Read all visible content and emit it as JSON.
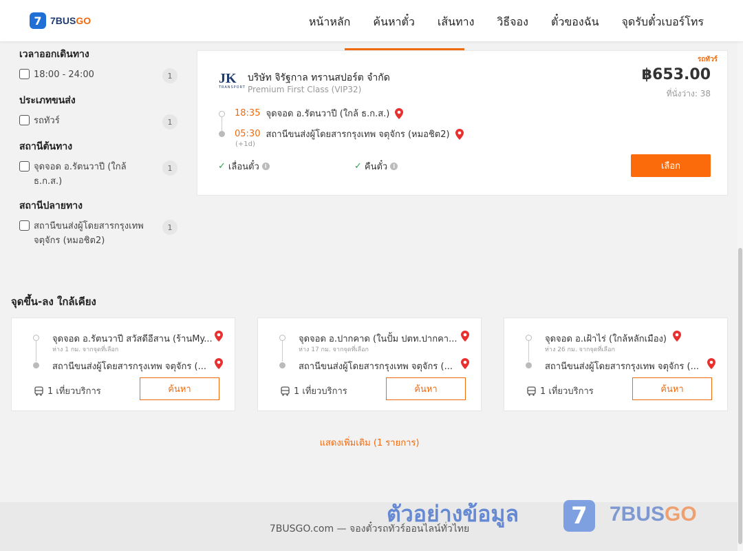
{
  "header": {
    "logo_seven": "7",
    "logo_bus": "7BUS",
    "logo_go": "GO",
    "nav": [
      "หน้าหลัก",
      "ค้นหาตั๋ว",
      "เส้นทาง",
      "วิธีจอง",
      "ตั๋วของฉัน",
      "จุดรับตั๋วเบอร์โทร"
    ]
  },
  "filters": [
    {
      "title": "เวลาออกเดินทาง",
      "items": [
        {
          "label": "18:00 - 24:00",
          "count": "1"
        }
      ]
    },
    {
      "title": "ประเภทขนส่ง",
      "items": [
        {
          "label": "รถทัวร์",
          "count": "1"
        }
      ]
    },
    {
      "title": "สถานีต้นทาง",
      "items": [
        {
          "label": "จุดจอด อ.รัตนวาปี (ใกล้ ธ.ก.ส.)",
          "count": "1"
        }
      ]
    },
    {
      "title": "สถานีปลายทาง",
      "items": [
        {
          "label": "สถานีขนส่งผู้โดยสารกรุงเทพ จตุจักร (หมอชิต2)",
          "count": "1"
        }
      ]
    }
  ],
  "trip": {
    "tag": "รถทัวร์",
    "operator_logo": "JK",
    "operator_logo_sub": "TRANSPORT",
    "operator": "บริษัท จิรัฐกาล ทรานสปอร์ต จำกัด",
    "class": "Premium First Class (VIP32)",
    "price": "฿653.00",
    "seats": "ที่นั่งว่าง: 38",
    "depart_time": "18:35",
    "depart_place": "จุดจอด อ.รัตนวาปี (ใกล้ ธ.ก.ส.)",
    "arrive_time": "05:30",
    "arrive_place": "สถานีขนส่งผู้โดยสารกรุงเทพ จตุจักร (หมอชิต2)",
    "next_day": "(+1d)",
    "feature_reschedule": "เลื่อนตั๋ว",
    "feature_refund": "คืนตั๋ว",
    "select_label": "เลือก"
  },
  "nearby": {
    "title": "จุดขึ้น-ลง ใกล้เคียง",
    "cards": [
      {
        "from": "จุดจอด อ.รัตนวาปี สวัสดีอีสาน (ร้านMy...",
        "distance": "ห่าง 1 กม. จากจุดที่เลือก",
        "to": "สถานีขนส่งผู้โดยสารกรุงเทพ จตุจักร (...",
        "trips": "1 เที่ยวบริการ",
        "button": "ค้นหา"
      },
      {
        "from": "จุดจอด อ.ปากคาด (ในปั้ม ปตท.ปากคา...",
        "distance": "ห่าง 17 กม. จากจุดที่เลือก",
        "to": "สถานีขนส่งผู้โดยสารกรุงเทพ จตุจักร (...",
        "trips": "1 เที่ยวบริการ",
        "button": "ค้นหา"
      },
      {
        "from": "จุดจอด อ.เฝ้าไร่ (ใกล้หลักเมือง)",
        "distance": "ห่าง 26 กม. จากจุดที่เลือก",
        "to": "สถานีขนส่งผู้โดยสารกรุงเทพ จตุจักร (...",
        "trips": "1 เที่ยวบริการ",
        "button": "ค้นหา"
      }
    ],
    "show_more": "แสดงเพิ่มเติม (1 รายการ)"
  },
  "footer": {
    "text": "7BUSGO.com — จองตั๋วรถทัวร์ออนไลน์ทั่วไทย"
  },
  "watermark": {
    "text": "ตัวอย่างข้อมูล",
    "logo_seven": "7",
    "logo_bus": "7BUS",
    "logo_go": "GO"
  },
  "colors": {
    "accent": "#f06a0d",
    "brand": "#1f6fd6"
  }
}
